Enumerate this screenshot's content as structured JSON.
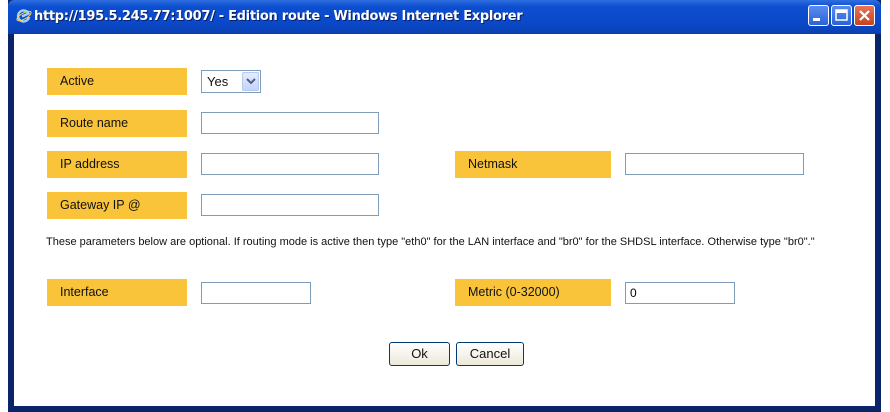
{
  "window": {
    "title": "http://195.5.245.77:1007/ - Edition route - Windows Internet Explorer"
  },
  "form": {
    "active": {
      "label": "Active",
      "value": "Yes",
      "options": [
        "Yes"
      ]
    },
    "route_name": {
      "label": "Route name",
      "value": ""
    },
    "ip_address": {
      "label": "IP address",
      "value": ""
    },
    "netmask": {
      "label": "Netmask",
      "value": ""
    },
    "gateway": {
      "label": "Gateway IP @",
      "value": ""
    },
    "note": "These parameters below are optional. If routing mode is active then type \"eth0\" for the LAN interface and \"br0\" for the SHDSL interface. Otherwise type \"br0\".\"",
    "interface": {
      "label": "Interface",
      "value": ""
    },
    "metric": {
      "label": "Metric (0-32000)",
      "value": "0"
    }
  },
  "buttons": {
    "ok": "Ok",
    "cancel": "Cancel"
  },
  "colors": {
    "label_bg": "#f9c43a",
    "titlebar": "#0a48c8",
    "close_button": "#c5431e"
  },
  "icons": [
    "ie-icon",
    "minimize-icon",
    "maximize-icon",
    "close-icon",
    "chevron-down-icon"
  ]
}
